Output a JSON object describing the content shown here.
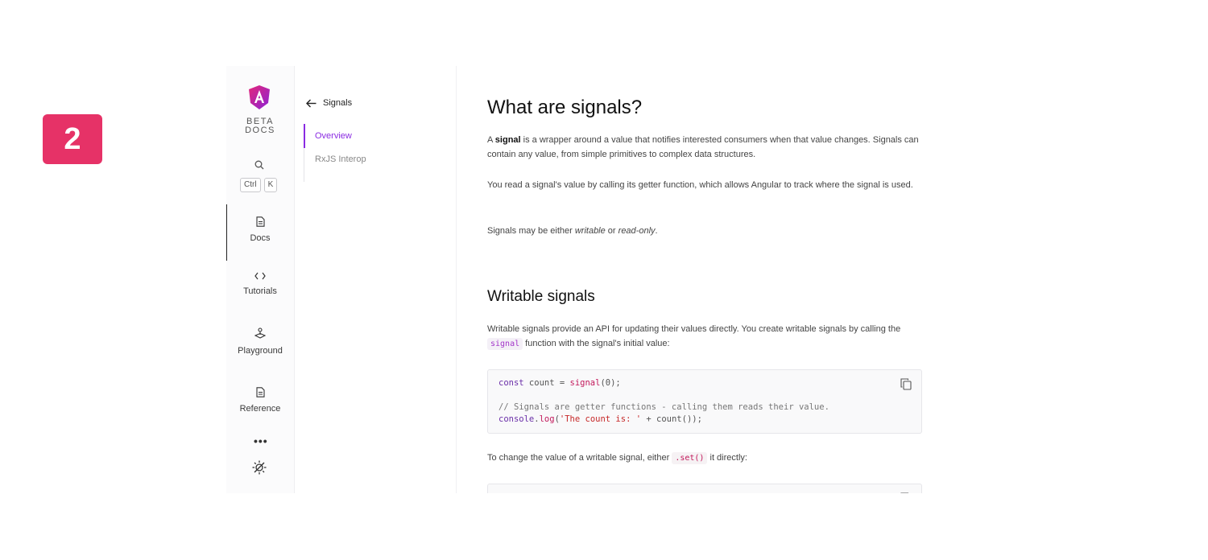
{
  "step_badge": "2",
  "rail": {
    "brand_line1": "BETA",
    "brand_line2": "DOCS",
    "search_key1": "Ctrl",
    "search_key2": "K",
    "items": [
      {
        "label": "Docs",
        "icon": "document-icon",
        "active": true
      },
      {
        "label": "Tutorials",
        "icon": "code-icon"
      },
      {
        "label": "Playground",
        "icon": "joystick-icon"
      },
      {
        "label": "Reference",
        "icon": "reference-icon"
      }
    ],
    "more": "•••",
    "theme_icon": "theme-toggle-icon"
  },
  "subnav": {
    "back_label": "Signals",
    "items": [
      {
        "label": "Overview",
        "active": true
      },
      {
        "label": "RxJS Interop"
      }
    ],
    "accent": "#8a2be2"
  },
  "content": {
    "title": "What are signals?",
    "p1_a": "A ",
    "p1_bold": "signal",
    "p1_b": " is a wrapper around a value that notifies interested consumers when that value changes. Signals can contain any value, from simple primitives to complex data structures.",
    "p2": "You read a signal's value by calling its getter function, which allows Angular to track where the signal is used.",
    "p3_a": "Signals may be either ",
    "p3_i1": "writable",
    "p3_b": " or ",
    "p3_i2": "read-only",
    "p3_c": ".",
    "h2": "Writable signals",
    "p4_a": "Writable signals provide an API for updating their values directly. You create writable signals by calling the ",
    "p4_code": "signal",
    "p4_b": " function with the signal's initial value:",
    "code1": {
      "l1_kw": "const",
      "l1_mid": " count = ",
      "l1_fn": "signal",
      "l1_end": "(0);",
      "l2": "// Signals are getter functions - calling them reads their value.",
      "l3_obj": "console",
      "l3_dot": ".",
      "l3_fn": "log",
      "l3_open": "(",
      "l3_str": "'The count is: '",
      "l3_end": " + count());"
    },
    "p5_a": "To change the value of a writable signal, either ",
    "p5_code": ".set()",
    "p5_b": " it directly:"
  }
}
